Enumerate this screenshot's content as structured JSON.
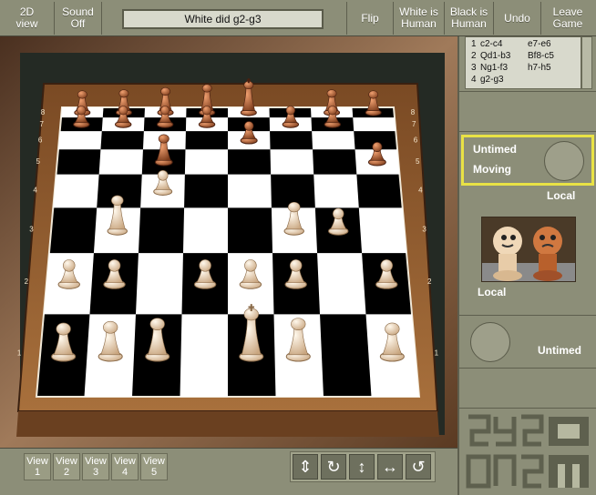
{
  "toolbar": {
    "view_mode": "2D\nview",
    "sound": "Sound\nOff",
    "status": "White did g2-g3",
    "flip": "Flip",
    "white_player": "White is\nHuman",
    "black_player": "Black is\nHuman",
    "undo": "Undo",
    "leave": "Leave\nGame"
  },
  "moves": [
    {
      "n": "1",
      "white": "c2-c4",
      "black": "e7-e6"
    },
    {
      "n": "2",
      "white": "Qd1-b3",
      "black": "Bf8-c5"
    },
    {
      "n": "3",
      "white": "Ng1-f3",
      "black": "h7-h5"
    },
    {
      "n": "4",
      "white": "g2-g3",
      "black": ""
    }
  ],
  "black_player": {
    "clock": "Untimed",
    "state": "Moving",
    "type": "Local"
  },
  "white_player": {
    "type": "Local",
    "clock": "Untimed"
  },
  "board": {
    "files": [
      "a",
      "b",
      "c",
      "d",
      "e",
      "f",
      "g",
      "h"
    ],
    "ranks": [
      "1",
      "2",
      "3",
      "4",
      "5",
      "6",
      "7",
      "8"
    ]
  },
  "views": [
    "View\n1",
    "View\n2",
    "View\n3",
    "View\n4",
    "View\n5"
  ],
  "controls": [
    "tilt-icon",
    "rotate-icon",
    "zoom-icon",
    "pan-icon",
    "spin-icon"
  ],
  "colors": {
    "active_border": "#e9e245",
    "light_square": "#ffffff",
    "dark_square": "#000000",
    "frame": "#8a5a32"
  }
}
